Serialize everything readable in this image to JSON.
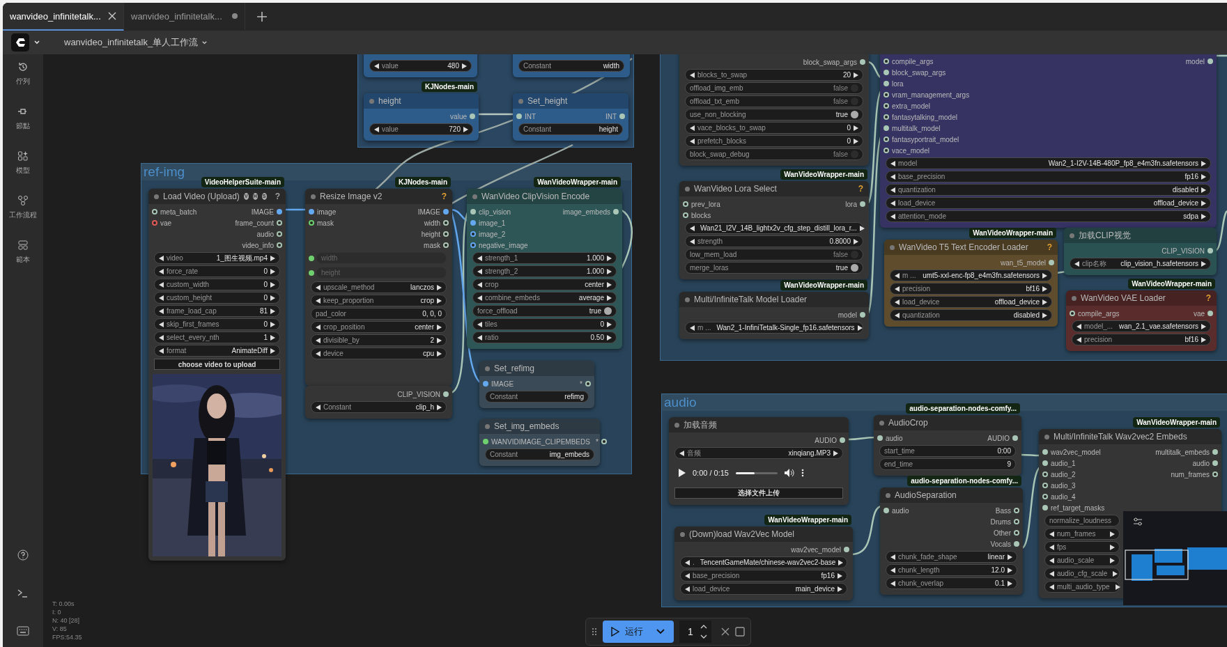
{
  "tabs": [
    {
      "label": "wanvideo_infinitetalk...",
      "selected": true,
      "modified": false
    },
    {
      "label": "wanvideo_infinitetalk...",
      "selected": false,
      "modified": true
    }
  ],
  "workflow_title": "wanvideo_infinitetalk_单人工作流",
  "sidebar": {
    "items": [
      {
        "kind": "history",
        "label": "佇列"
      },
      {
        "kind": "node",
        "label": "節點"
      },
      {
        "kind": "model",
        "label": "模型"
      },
      {
        "kind": "workflow",
        "label": "工作流程"
      },
      {
        "kind": "template",
        "label": "範本"
      }
    ]
  },
  "groups": [
    {
      "color": "#2a4660"
    },
    {
      "title": "ref-img",
      "color": "#29445a"
    },
    {
      "color": "#29445a"
    },
    {
      "title": "audio",
      "color": "#29445a"
    }
  ],
  "nodes": [
    {
      "color": "#2d5b8a",
      "widgets": [
        {
          "kind": "stepper",
          "label": "value",
          "value": "480"
        }
      ]
    },
    {
      "color": "#2d5b8a",
      "widgets": [
        {
          "kind": "text",
          "label": "Constant",
          "value": "width"
        }
      ]
    },
    {
      "title": "height",
      "badge": "KJNodes-main",
      "color": "#2d5b8a",
      "outputs": [
        {
          "name": "value",
          "connected": true
        }
      ],
      "widgets": [
        {
          "kind": "stepper",
          "label": "value",
          "value": "720"
        }
      ]
    },
    {
      "title": "Set_height",
      "color": "#2d5b8a",
      "inputs": [
        {
          "name": "INT",
          "connected": true
        }
      ],
      "outputs": [
        {
          "name": "INT",
          "connected": true
        }
      ],
      "widgets": [
        {
          "kind": "text",
          "label": "Constant",
          "value": "height"
        }
      ]
    },
    {
      "title": "Load Video (Upload)",
      "badge": "VideoHelperSuite-main",
      "title_marks": [
        "V",
        "H",
        "S"
      ],
      "help": {
        "text": "?",
        "color": "#a0a0a0"
      },
      "color": "#353535",
      "inputs": [
        {
          "name": "meta_batch",
          "connected": false
        },
        {
          "name": "vae",
          "connected": false,
          "color": "#e05a5a"
        }
      ],
      "outputs": [
        {
          "name": "IMAGE",
          "connected": true,
          "color": "#64a8f0"
        },
        {
          "name": "frame_count",
          "connected": false
        },
        {
          "name": "audio",
          "connected": false
        },
        {
          "name": "video_info",
          "connected": false
        }
      ],
      "widgets": [
        {
          "kind": "stepper",
          "label": "video",
          "value": "1_图生视频.mp4"
        },
        {
          "kind": "stepper",
          "label": "force_rate",
          "value": "0"
        },
        {
          "kind": "stepper",
          "label": "custom_width",
          "value": "0"
        },
        {
          "kind": "stepper",
          "label": "custom_height",
          "value": "0"
        },
        {
          "kind": "stepper",
          "label": "frame_load_cap",
          "value": "81"
        },
        {
          "kind": "stepper",
          "label": "skip_first_frames",
          "value": "0"
        },
        {
          "kind": "stepper",
          "label": "select_every_nth",
          "value": "1"
        },
        {
          "kind": "stepper",
          "label": "format",
          "value": "AnimateDiff"
        },
        {
          "kind": "button",
          "label": "choose video to upload"
        },
        {
          "kind": "picture"
        }
      ]
    },
    {
      "title": "Resize Image v2",
      "badge": "KJNodes-main",
      "help": {
        "text": "?",
        "color": "#e0a030"
      },
      "color": "#353535",
      "inputs": [
        {
          "name": "image",
          "connected": true,
          "color": "#64a8f0"
        },
        {
          "name": "mask",
          "connected": false,
          "color": "#6fd06f"
        }
      ],
      "outputs": [
        {
          "name": "IMAGE",
          "connected": true,
          "color": "#64a8f0"
        },
        {
          "name": "width",
          "connected": false
        },
        {
          "name": "height",
          "connected": false
        },
        {
          "name": "mask",
          "connected": false
        }
      ],
      "widgets": [
        {
          "kind": "linked",
          "label": "width",
          "connected": true
        },
        {
          "kind": "linked",
          "label": "height",
          "connected": true
        },
        {
          "kind": "stepper",
          "label": "upscale_method",
          "value": "lanczos"
        },
        {
          "kind": "stepper",
          "label": "keep_proportion",
          "value": "crop"
        },
        {
          "kind": "text",
          "label": "pad_color",
          "value": "0, 0, 0"
        },
        {
          "kind": "stepper",
          "label": "crop_position",
          "value": "center"
        },
        {
          "kind": "stepper",
          "label": "divisible_by",
          "value": "2"
        },
        {
          "kind": "stepper",
          "label": "device",
          "value": "cpu"
        }
      ]
    },
    {
      "color": "#353535",
      "outputs": [
        {
          "name": "CLIP_VISION",
          "connected": true
        }
      ],
      "widgets": [
        {
          "kind": "stepper",
          "label": "Constant",
          "value": "clip_h"
        }
      ]
    },
    {
      "title": "WanVideo ClipVision Encode",
      "badge": "WanVideoWrapper-main",
      "color": "#2e5656",
      "inputs": [
        {
          "name": "clip_vision",
          "connected": true
        },
        {
          "name": "image_1",
          "connected": true,
          "color": "#64a8f0"
        },
        {
          "name": "image_2",
          "connected": false,
          "color": "#64a8f0"
        },
        {
          "name": "negative_image",
          "connected": false,
          "color": "#64a8f0"
        }
      ],
      "outputs": [
        {
          "name": "image_embeds",
          "connected": true
        }
      ],
      "widgets": [
        {
          "kind": "stepper",
          "label": "strength_1",
          "value": "1.000"
        },
        {
          "kind": "stepper",
          "label": "strength_2",
          "value": "1.000"
        },
        {
          "kind": "stepper",
          "label": "crop",
          "value": "center"
        },
        {
          "kind": "stepper",
          "label": "combine_embeds",
          "value": "average"
        },
        {
          "kind": "toggle",
          "label": "force_offload",
          "value": "true",
          "on": true
        },
        {
          "kind": "stepper",
          "label": "tiles",
          "value": "0"
        },
        {
          "kind": "stepper",
          "label": "ratio",
          "value": "0.50"
        }
      ]
    },
    {
      "title": "Set_refimg",
      "color": "#3a4a56",
      "inputs": [
        {
          "name": "IMAGE",
          "connected": true,
          "color": "#64a8f0"
        }
      ],
      "outputs": [
        {
          "name": "*",
          "connected": false
        }
      ],
      "widgets": [
        {
          "kind": "text",
          "label": "Constant",
          "value": "refimg"
        }
      ]
    },
    {
      "title": "Set_img_embeds",
      "color": "#3a4a56",
      "inputs": [
        {
          "name": "WANVIDIMAGE_CLIPEMBEDS",
          "connected": true,
          "color": "#6fd06f"
        }
      ],
      "outputs": [
        {
          "name": "*",
          "connected": false
        }
      ],
      "widgets": [
        {
          "kind": "text",
          "label": "Constant",
          "value": "img_embeds"
        }
      ]
    },
    {
      "color": "#353535",
      "outputs": [
        {
          "name": "block_swap_args",
          "connected": true
        }
      ],
      "widgets": [
        {
          "kind": "stepper",
          "label": "blocks_to_swap",
          "value": "20"
        },
        {
          "kind": "toggle",
          "label": "offload_img_emb",
          "value": "false",
          "on": false
        },
        {
          "kind": "toggle",
          "label": "offload_txt_emb",
          "value": "false",
          "on": false
        },
        {
          "kind": "toggle",
          "label": "use_non_blocking",
          "value": "true",
          "on": true
        },
        {
          "kind": "stepper",
          "label": "vace_blocks_to_swap",
          "value": "0"
        },
        {
          "kind": "stepper",
          "label": "prefetch_blocks",
          "value": "0"
        },
        {
          "kind": "toggle",
          "label": "block_swap_debug",
          "value": "false",
          "on": false
        }
      ]
    },
    {
      "color": "#363262",
      "inputs": [
        {
          "name": "compile_args",
          "connected": false
        },
        {
          "name": "block_swap_args",
          "connected": true
        },
        {
          "name": "lora",
          "connected": true
        },
        {
          "name": "vram_management_args",
          "connected": false
        },
        {
          "name": "extra_model",
          "connected": false
        },
        {
          "name": "fantasytalking_model",
          "connected": false
        },
        {
          "name": "multitalk_model",
          "connected": true
        },
        {
          "name": "fantasyportrait_model",
          "connected": false
        },
        {
          "name": "vace_model",
          "connected": false
        }
      ],
      "outputs": [
        {
          "name": "model",
          "connected": true
        }
      ],
      "widgets": [
        {
          "kind": "stepper",
          "label": "model",
          "value": "Wan2_1-I2V-14B-480P_fp8_e4m3fn.safetensors"
        },
        {
          "kind": "stepper",
          "label": "base_precision",
          "value": "fp16"
        },
        {
          "kind": "stepper",
          "label": "quantization",
          "value": "disabled"
        },
        {
          "kind": "stepper",
          "label": "load_device",
          "value": "offload_device"
        },
        {
          "kind": "stepper",
          "label": "attention_mode",
          "value": "sdpa"
        }
      ]
    },
    {
      "title": "WanVideo Lora Select",
      "badge": "WanVideoWrapper-main",
      "help": {
        "text": "?",
        "color": "#e0a030"
      },
      "color": "#353535",
      "inputs": [
        {
          "name": "prev_lora",
          "connected": false
        },
        {
          "name": "blocks",
          "connected": false
        }
      ],
      "outputs": [
        {
          "name": "lora",
          "connected": true
        }
      ],
      "widgets": [
        {
          "kind": "stepper",
          "value": "Wan21_I2V_14B_lightx2v_cfg_step_distill_lora_r..."
        },
        {
          "kind": "stepper",
          "label": "strength",
          "value": "0.8000"
        },
        {
          "kind": "toggle",
          "label": "low_mem_load",
          "value": "false",
          "on": false
        },
        {
          "kind": "toggle",
          "label": "merge_loras",
          "value": "true",
          "on": true
        }
      ]
    },
    {
      "title": "Multi/InfiniteTalk Model Loader",
      "badge": "WanVideoWrapper-main",
      "color": "#353535",
      "outputs": [
        {
          "name": "model",
          "connected": true
        }
      ],
      "widgets": [
        {
          "kind": "stepper",
          "label": "m ...",
          "value": "Wan2_1-InfiniTetalk-Single_fp16.safetensors"
        }
      ]
    },
    {
      "title": "WanVideo T5 Text Encoder Loader",
      "badge": "WanVideoWrapper-main",
      "help": {
        "text": "?",
        "color": "#e0a030"
      },
      "color": "#5e4c2c",
      "outputs": [
        {
          "name": "wan_t5_model",
          "connected": true
        }
      ],
      "widgets": [
        {
          "kind": "stepper",
          "label": "m ...",
          "value": "umt5-xxl-enc-fp8_e4m3fn.safetensors"
        },
        {
          "kind": "stepper",
          "label": "precision",
          "value": "bf16"
        },
        {
          "kind": "stepper",
          "label": "load_device",
          "value": "offload_device"
        },
        {
          "kind": "stepper",
          "label": "quantization",
          "value": "disabled"
        }
      ]
    },
    {
      "title": "加载CLIP视觉",
      "color": "#2b5252",
      "outputs": [
        {
          "name": "CLIP_VISION",
          "connected": true
        }
      ],
      "widgets": [
        {
          "kind": "stepper",
          "label": "clip名称",
          "value": "clip_vision_h.safetensors"
        }
      ]
    },
    {
      "title": "WanVideo VAE Loader",
      "badge": "WanVideoWrapper-main",
      "help": {
        "text": "?",
        "color": "#e0a030"
      },
      "color": "#5a2c2c",
      "inputs": [
        {
          "name": "compile_args",
          "connected": false
        }
      ],
      "outputs": [
        {
          "name": "vae",
          "connected": true
        }
      ],
      "widgets": [
        {
          "kind": "stepper",
          "label": "model_...",
          "value": "wan_2.1_vae.safetensors"
        },
        {
          "kind": "stepper",
          "label": "precision",
          "value": "bf16"
        }
      ]
    },
    {
      "title": "加载音频",
      "color": "#353535",
      "outputs": [
        {
          "name": "AUDIO",
          "connected": true
        }
      ],
      "widgets": [
        {
          "kind": "stepper",
          "label": "音频",
          "value": "xinqiang.MP3"
        },
        {
          "kind": "audio",
          "time": "0:00 / 0:15",
          "level": 0.45
        },
        {
          "kind": "button",
          "label": "选择文件上传"
        }
      ]
    },
    {
      "title": "AudioCrop",
      "badge": "audio-separation-nodes-comfy...",
      "color": "#353535",
      "inputs": [
        {
          "name": "audio",
          "connected": true
        }
      ],
      "outputs": [
        {
          "name": "AUDIO",
          "connected": true
        }
      ],
      "widgets": [
        {
          "kind": "text",
          "label": "start_time",
          "value": "0:00"
        },
        {
          "kind": "text",
          "label": "end_time",
          "value": "9"
        }
      ]
    },
    {
      "title": "AudioSeparation",
      "badge": "audio-separation-nodes-comfy...",
      "color": "#353535",
      "inputs": [
        {
          "name": "audio",
          "connected": true
        }
      ],
      "outputs": [
        {
          "name": "Bass",
          "connected": false
        },
        {
          "name": "Drums",
          "connected": false
        },
        {
          "name": "Other",
          "connected": false
        },
        {
          "name": "Vocals",
          "connected": true
        }
      ],
      "widgets": [
        {
          "kind": "stepper",
          "label": "chunk_fade_shape",
          "value": "linear"
        },
        {
          "kind": "stepper",
          "label": "chunk_length",
          "value": "12.0"
        },
        {
          "kind": "stepper",
          "label": "chunk_overlap",
          "value": "0.1"
        }
      ]
    },
    {
      "title": "(Down)load Wav2Vec Model",
      "badge": "WanVideoWrapper-main",
      "color": "#353535",
      "outputs": [
        {
          "name": "wav2vec_model",
          "connected": true
        }
      ],
      "widgets": [
        {
          "kind": "stepper",
          "label": ".",
          "value": "TencentGameMate/chinese-wav2vec2-base"
        },
        {
          "kind": "stepper",
          "label": "base_precision",
          "value": "fp16"
        },
        {
          "kind": "stepper",
          "label": "load_device",
          "value": "main_device"
        }
      ]
    },
    {
      "title": "Multi/InfiniteTalk Wav2vec2 Embeds",
      "badge": "WanVideoWrapper-main",
      "color": "#353535",
      "inputs": [
        {
          "name": "wav2vec_model",
          "connected": true
        },
        {
          "name": "audio_1",
          "connected": true
        },
        {
          "name": "audio_2",
          "connected": false
        },
        {
          "name": "audio_3",
          "connected": false
        },
        {
          "name": "audio_4",
          "connected": false
        },
        {
          "name": "ref_target_masks",
          "connected": true
        }
      ],
      "outputs": [
        {
          "name": "multitalk_embeds",
          "connected": true
        },
        {
          "name": "audio",
          "connected": true
        },
        {
          "name": "num_frames",
          "connected": false
        }
      ],
      "widgets": [
        {
          "kind": "text",
          "label": "normalize_loudness"
        },
        {
          "kind": "stepper",
          "label": "num_frames"
        },
        {
          "kind": "stepper",
          "label": "fps"
        },
        {
          "kind": "stepper",
          "label": "audio_scale"
        },
        {
          "kind": "stepper",
          "label": "audio_cfg_scale"
        },
        {
          "kind": "stepper",
          "label": "multi_audio_type"
        }
      ]
    }
  ],
  "stats": [
    "T: 0.00s",
    "I: 0",
    "N: 40 [28]",
    "V: 85",
    "FPS:54.35"
  ],
  "toolbar": {
    "run_label": "运行",
    "count": "1"
  }
}
